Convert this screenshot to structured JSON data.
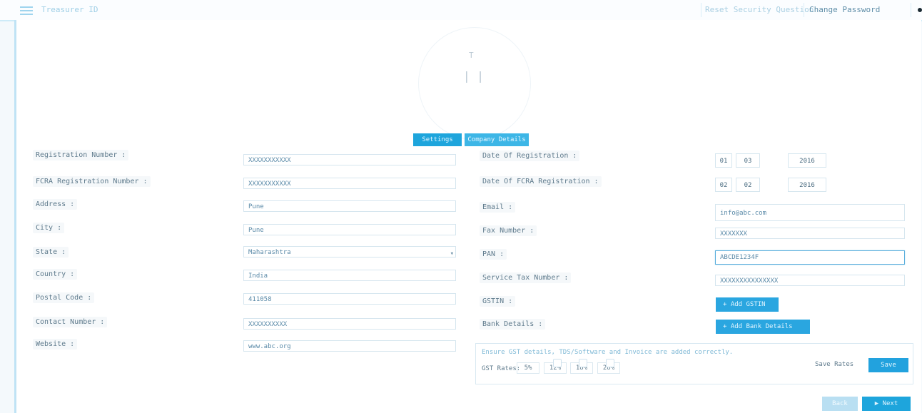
{
  "header": {
    "app_title": "Treasurer ID",
    "reset_link": "Reset Security Question",
    "user_menu": "Change Password"
  },
  "logo": {
    "mark": "T",
    "body": "| |"
  },
  "tabs": [
    {
      "label": "Settings"
    },
    {
      "label": "Company Details"
    }
  ],
  "left_fields": [
    {
      "label": "Registration Number :",
      "value": "XXXXXXXXXXX"
    },
    {
      "label": "FCRA Registration Number :",
      "value": "XXXXXXXXXXX"
    },
    {
      "label": "Address :",
      "value": "Pune"
    },
    {
      "label": "City :",
      "value": "Pune"
    },
    {
      "label": "State :",
      "value": "Maharashtra"
    },
    {
      "label": "Country :",
      "value": "India"
    },
    {
      "label": "Postal Code :",
      "value": "411058"
    },
    {
      "label": "Contact Number :",
      "value": "XXXXXXXXXX"
    },
    {
      "label": "Website :",
      "value": "www.abc.org"
    }
  ],
  "right_fields": {
    "date_registration": {
      "label": "Date Of Registration :",
      "day": "01",
      "month": "03",
      "year": "2016"
    },
    "date_fcra": {
      "label": "Date Of FCRA Registration :",
      "day": "02",
      "month": "02",
      "year": "2016"
    },
    "email": {
      "label": "Email :",
      "value": "info@abc.com"
    },
    "fax": {
      "label": "Fax Number :",
      "value": "XXXXXXX"
    },
    "pan": {
      "label": "PAN :",
      "value": "ABCDE1234F"
    },
    "service_tax": {
      "label": "Service Tax Number :",
      "value": "XXXXXXXXXXXXXXX"
    },
    "gstin": {
      "label": "GSTIN :",
      "button": "+ Add GSTIN"
    },
    "bank": {
      "label": "Bank Details :",
      "button": "+ Add Bank Details"
    }
  },
  "bank_panel": {
    "line1": "Ensure GST details, TDS/Software and Invoice are added correctly.",
    "gst_rates_label": "GST Rates:",
    "rates": [
      "5%",
      "12%",
      "18%",
      "28%"
    ],
    "save_note": "Save Rates",
    "save_button": "Save"
  },
  "footer": {
    "back": "Back",
    "next": "▶ Next"
  }
}
